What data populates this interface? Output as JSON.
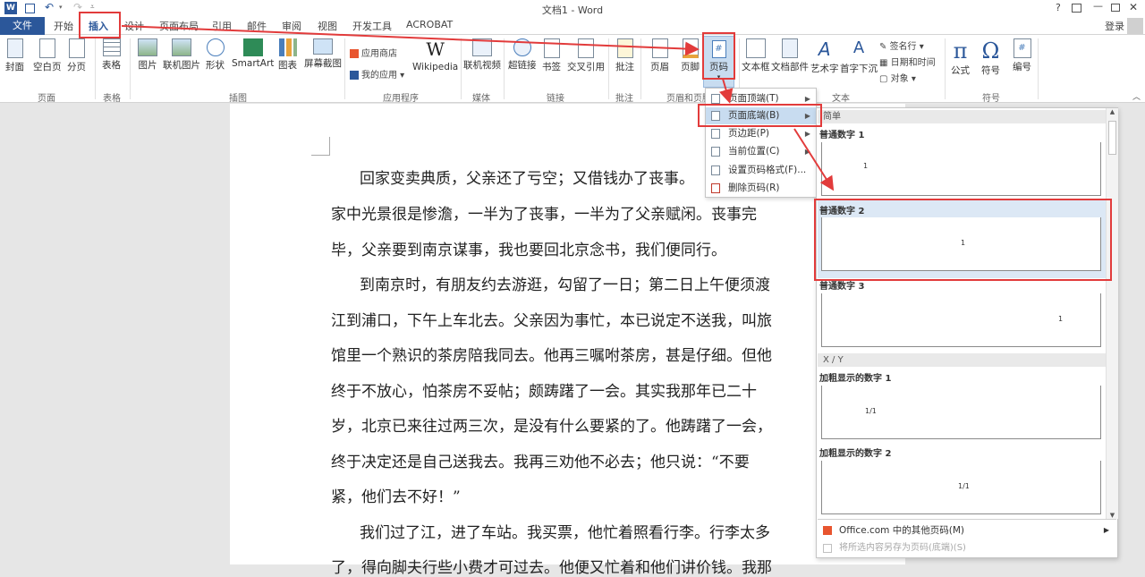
{
  "window": {
    "title": "文档1 - Word",
    "help": "?",
    "login": "登录"
  },
  "tabs": [
    "文件",
    "开始",
    "插入",
    "设计",
    "页面布局",
    "引用",
    "邮件",
    "审阅",
    "视图",
    "开发工具",
    "ACROBAT"
  ],
  "ribbon": {
    "pages_group": {
      "label": "页面",
      "buttons": [
        "封面",
        "空白页",
        "分页"
      ]
    },
    "table_group": {
      "label": "表格",
      "buttons": [
        "表格"
      ]
    },
    "illus_group": {
      "label": "插图",
      "buttons": [
        "图片",
        "联机图片",
        "形状",
        "SmartArt",
        "图表",
        "屏幕截图"
      ]
    },
    "apps_group": {
      "label": "应用程序",
      "store": "应用商店",
      "myapps": "我的应用",
      "wiki": "Wikipedia"
    },
    "media_group": {
      "label": "媒体",
      "buttons": [
        "联机视频"
      ]
    },
    "links_group": {
      "label": "链接",
      "buttons": [
        "超链接",
        "书签",
        "交叉引用"
      ]
    },
    "comment_group": {
      "label": "批注",
      "buttons": [
        "批注"
      ]
    },
    "hf_group": {
      "label": "页眉和页脚",
      "buttons": [
        "页眉",
        "页脚",
        "页码"
      ]
    },
    "text_group": {
      "label": "文本",
      "buttons": [
        "文本框",
        "文档部件",
        "艺术字",
        "首字下沉"
      ],
      "small": [
        "签名行",
        "日期和时间",
        "对象"
      ]
    },
    "symbol_group": {
      "label": "符号",
      "buttons": [
        "公式",
        "符号",
        "编号"
      ]
    }
  },
  "menu": {
    "items": [
      "页面顶端(T)",
      "页面底端(B)",
      "页边距(P)",
      "当前位置(C)",
      "设置页码格式(F)...",
      "删除页码(R)"
    ]
  },
  "gallery": {
    "section_simple": "简单",
    "items": [
      "普通数字 1",
      "普通数字 2",
      "普通数字 3"
    ],
    "section_xy": "X / Y",
    "bold_items": [
      "加粗显示的数字 1",
      "加粗显示的数字 2"
    ],
    "num_simple": "1",
    "num_xy": "1/1",
    "footer_more": "Office.com 中的其他页码(M)",
    "footer_save": "将所选内容另存为页码(底端)(S)"
  },
  "document": {
    "lines": [
      "回家变卖典质，父亲还了亏空；又借钱办了丧事。",
      "家中光景很是惨澹，一半为了丧事，一半为了父亲赋闲。丧事完",
      "毕，父亲要到南京谋事，我也要回北京念书，我们便同行。",
      "到南京时，有朋友约去游逛，勾留了一日；第二日上午便须渡",
      "江到浦口，下午上车北去。父亲因为事忙，本已说定不送我，叫旅",
      "馆里一个熟识的茶房陪我同去。他再三嘱咐茶房，甚是仔细。但他",
      "终于不放心，怕茶房不妥帖；颇踌躇了一会。其实我那年已二十",
      "岁，北京已来往过两三次，是没有什么要紧的了。他踌躇了一会，",
      "终于决定还是自己送我去。我再三劝他不必去；他只说：“不要",
      "紧，他们去不好！”",
      "我们过了江，进了车站。我买票，他忙着照看行李。行李太多",
      "了，得向脚夫行些小费才可过去。他便又忙着和他们讲价钱。我那"
    ]
  },
  "colors": {
    "accent": "#2b579a",
    "highlight": "#e23b3b"
  }
}
